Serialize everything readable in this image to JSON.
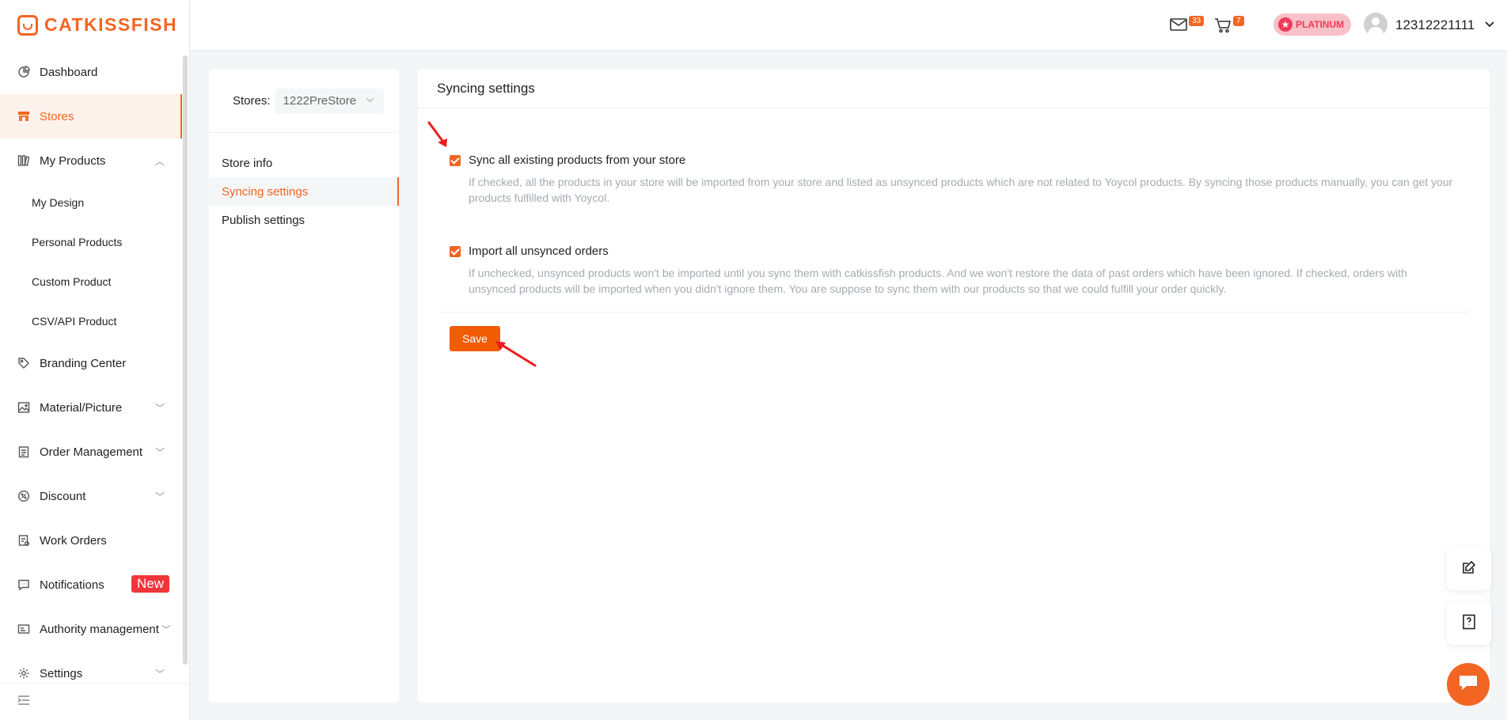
{
  "brand": {
    "name": "CATKISSFISH",
    "color": "#f26522"
  },
  "sidebar": {
    "items": [
      {
        "label": "Dashboard",
        "icon": "pie-chart-icon"
      },
      {
        "label": "Stores",
        "icon": "store-icon",
        "active": true
      },
      {
        "label": "My Products",
        "icon": "products-icon",
        "expanded": true
      },
      {
        "label": "Branding Center",
        "icon": "tag-icon"
      },
      {
        "label": "Material/Picture",
        "icon": "image-icon"
      },
      {
        "label": "Order Management",
        "icon": "clipboard-icon"
      },
      {
        "label": "Discount",
        "icon": "discount-icon"
      },
      {
        "label": "Work Orders",
        "icon": "work-order-icon"
      },
      {
        "label": "Notifications",
        "icon": "message-icon",
        "badge": "New"
      },
      {
        "label": "Authority management",
        "icon": "id-card-icon"
      },
      {
        "label": "Settings",
        "icon": "gear-icon"
      }
    ],
    "sub_items": [
      "My Design",
      "Personal Products",
      "Custom Product",
      "CSV/API Product"
    ]
  },
  "header": {
    "mail_count": "33",
    "cart_count": "7",
    "membership": "PLATINUM",
    "username": "12312221111"
  },
  "store_panel": {
    "stores_label": "Stores:",
    "selected_store": "1222PreStore",
    "menu": [
      "Store info",
      "Syncing settings",
      "Publish settings"
    ],
    "active_menu": "Syncing settings"
  },
  "main": {
    "title": "Syncing settings",
    "options": [
      {
        "label": "Sync all existing products from your store",
        "checked": true,
        "description": "If checked, all the products in your store will be imported from your store and listed as unsynced products which are not related to Yoycol products. By syncing those products manually, you can get your products fulfilled with Yoycol."
      },
      {
        "label": "Import all unsynced orders",
        "checked": true,
        "description": "If unchecked, unsynced products won't be imported until you sync them with catkissfish products. And we won't restore the data of past orders which have been ignored. If checked, orders with unsynced products will be imported when you didn't ignore them. You are suppose to sync them with our products so that we could fulfill your order quickly."
      }
    ],
    "save_label": "Save"
  },
  "floating": {
    "icons": [
      "edit-icon",
      "guide-book-icon",
      "chat-icon"
    ]
  }
}
